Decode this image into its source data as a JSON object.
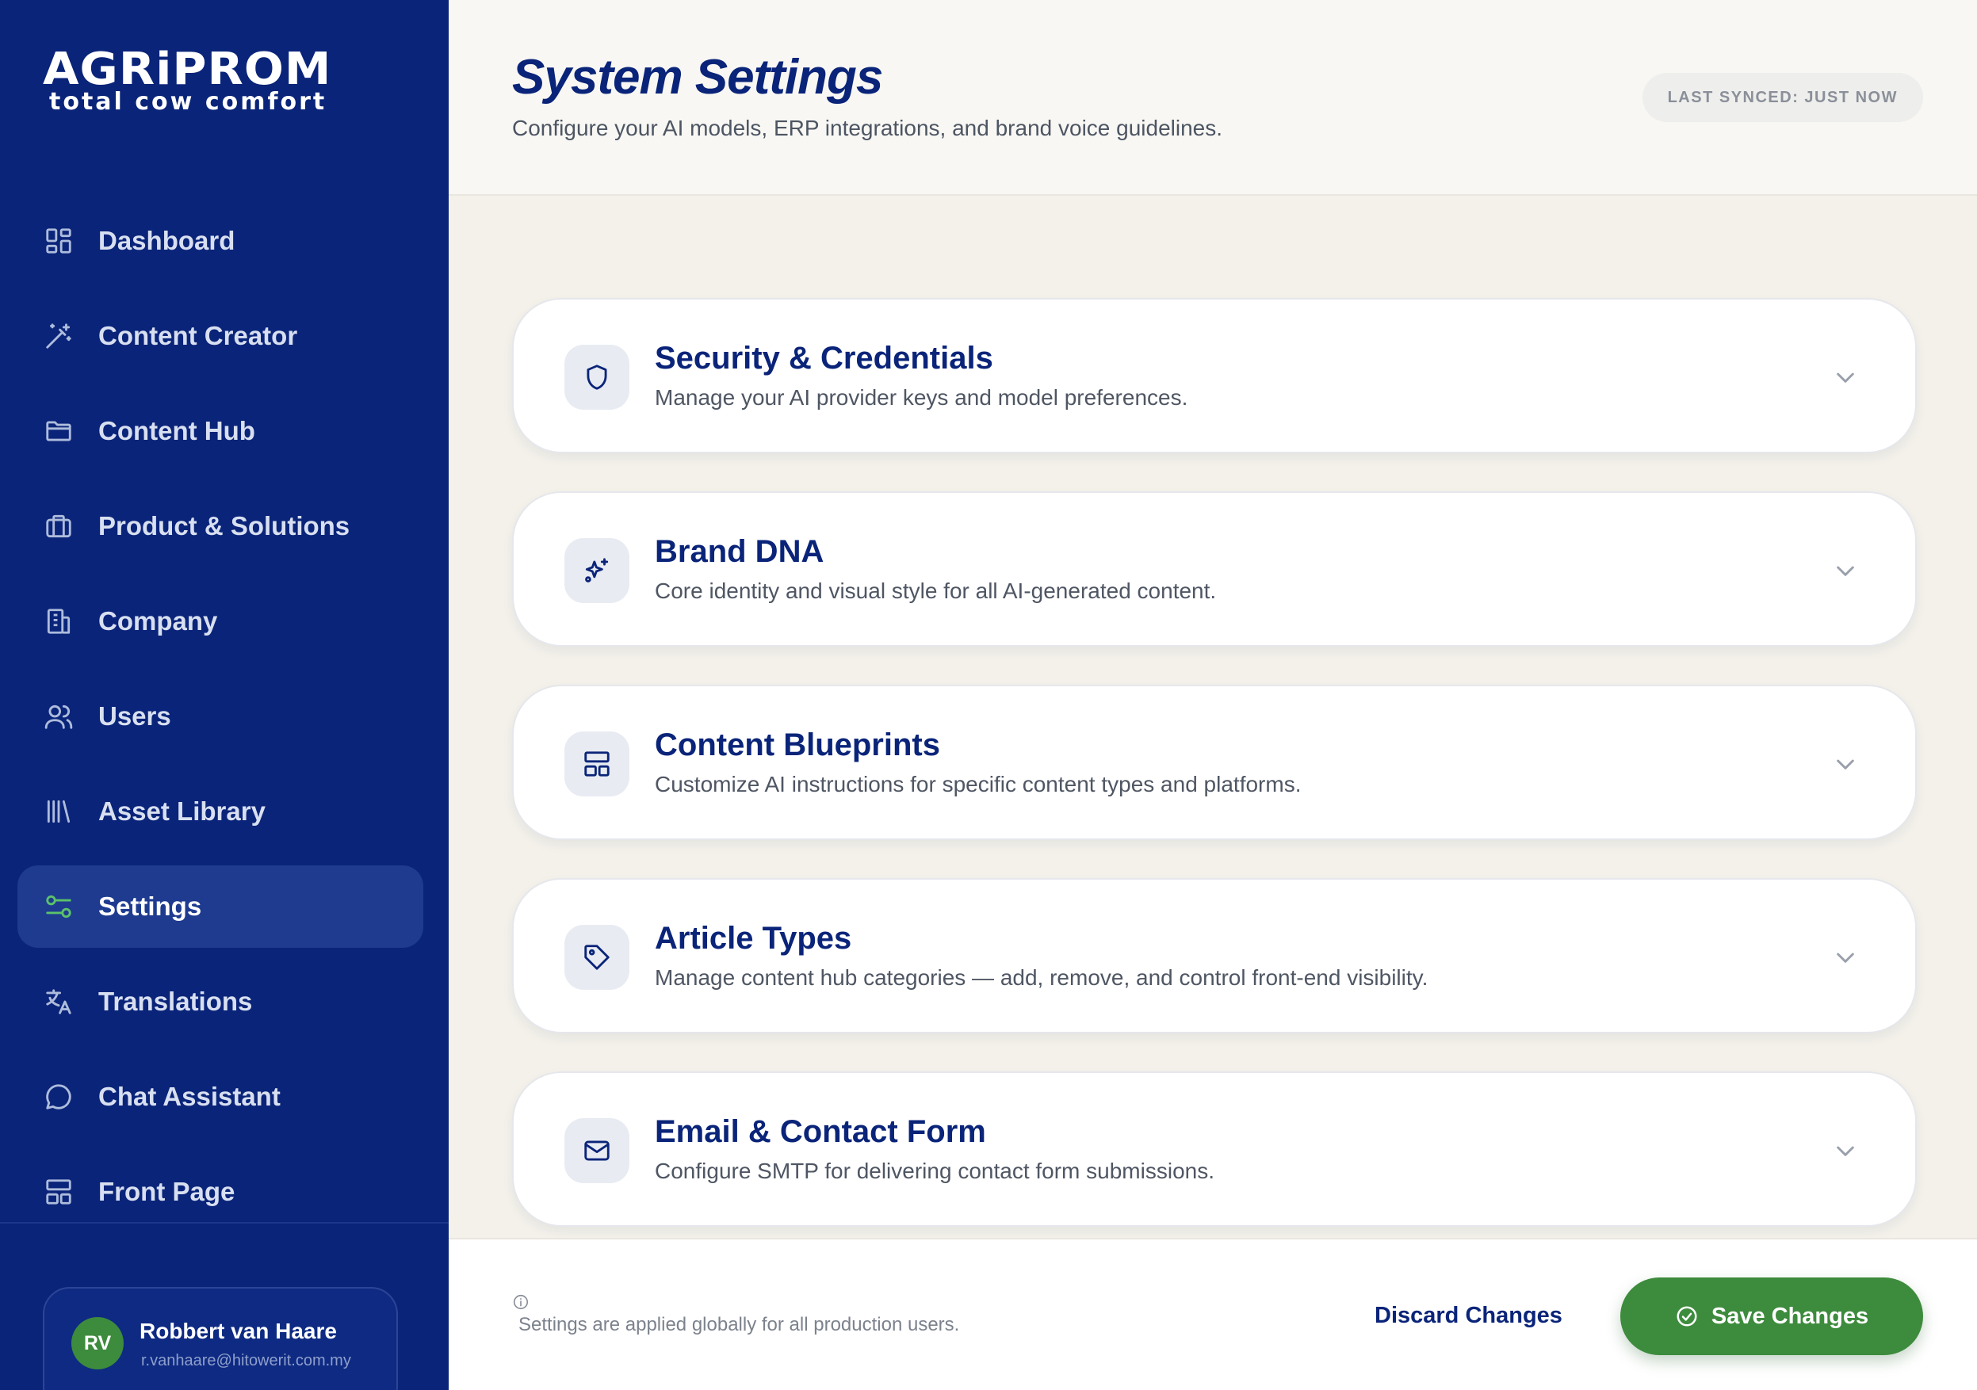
{
  "brand": {
    "name": "AGRiPROM",
    "tagline": "total cow comfort"
  },
  "sidebar": {
    "items": [
      {
        "label": "Dashboard",
        "icon": "dashboard-icon",
        "active": false
      },
      {
        "label": "Content Creator",
        "icon": "magic-wand-icon",
        "active": false
      },
      {
        "label": "Content Hub",
        "icon": "folder-icon",
        "active": false
      },
      {
        "label": "Product & Solutions",
        "icon": "briefcase-icon",
        "active": false
      },
      {
        "label": "Company",
        "icon": "building-icon",
        "active": false
      },
      {
        "label": "Users",
        "icon": "users-icon",
        "active": false
      },
      {
        "label": "Asset Library",
        "icon": "library-icon",
        "active": false
      },
      {
        "label": "Settings",
        "icon": "sliders-icon",
        "active": true
      },
      {
        "label": "Translations",
        "icon": "translate-icon",
        "active": false
      },
      {
        "label": "Chat Assistant",
        "icon": "chat-icon",
        "active": false
      },
      {
        "label": "Front Page",
        "icon": "layout-icon",
        "active": false
      }
    ]
  },
  "user": {
    "initials": "RV",
    "name": "Robbert van Haare",
    "email": "r.vanhaare@hitowerit.com.my"
  },
  "header": {
    "title": "System Settings",
    "subtitle": "Configure your AI models, ERP integrations, and brand voice guidelines.",
    "sync_status": "LAST SYNCED: JUST NOW"
  },
  "sections": [
    {
      "title": "Security & Credentials",
      "description": "Manage your AI provider keys and model preferences.",
      "icon": "shield-icon"
    },
    {
      "title": "Brand DNA",
      "description": "Core identity and visual style for all AI-generated content.",
      "icon": "sparkles-icon"
    },
    {
      "title": "Content Blueprints",
      "description": "Customize AI instructions for specific content types and platforms.",
      "icon": "layout-icon"
    },
    {
      "title": "Article Types",
      "description": "Manage content hub categories — add, remove, and control front-end visibility.",
      "icon": "tag-icon"
    },
    {
      "title": "Email & Contact Form",
      "description": "Configure SMTP for delivering contact form submissions.",
      "icon": "mail-icon"
    }
  ],
  "footer": {
    "info": "Settings are applied globally for all production users.",
    "discard_label": "Discard Changes",
    "save_label": "Save Changes"
  },
  "colors": {
    "sidebar": "#0a2479",
    "accent_green": "#3d8b3d",
    "title_blue": "#0a2479",
    "background": "#f3f1ea"
  }
}
